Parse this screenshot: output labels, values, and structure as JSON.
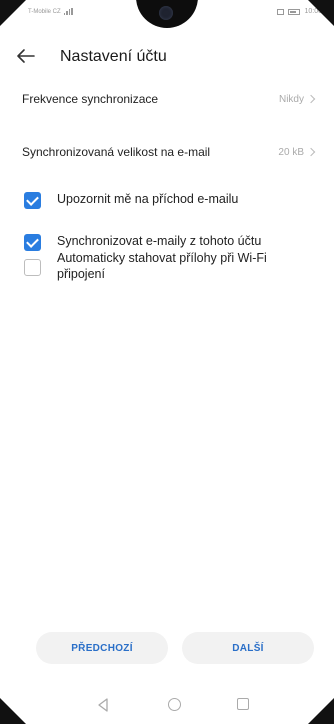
{
  "status_bar": {
    "carrier": "T-Mobile CZ",
    "time": "10:00",
    "icons": [
      "signal-icon",
      "sim-icon",
      "battery-icon"
    ]
  },
  "header": {
    "back_icon": "arrow-left-icon",
    "title": "Nastavení účtu"
  },
  "settings": [
    {
      "label": "Frekvence synchronizace",
      "value": "Nikdy"
    },
    {
      "label": "Synchronizovaná velikost na e-mail",
      "value": "20 kB"
    }
  ],
  "options": [
    {
      "label": "Upozornit mě na příchod e-mailu",
      "checked": true
    },
    {
      "label": "Synchronizovat e-maily z tohoto účtu",
      "checked": true
    },
    {
      "label": "Automaticky stahovat přílohy při Wi-Fi připojení",
      "checked": false
    }
  ],
  "buttons": {
    "previous": "PŘEDCHOZÍ",
    "next": "DALŠÍ"
  },
  "navbar": {
    "icons": [
      "nav-back-icon",
      "nav-home-icon",
      "nav-recents-icon"
    ]
  },
  "colors": {
    "accent": "#2a7de0",
    "button_text": "#2a6fc8",
    "button_bg": "#f2f2f2"
  }
}
